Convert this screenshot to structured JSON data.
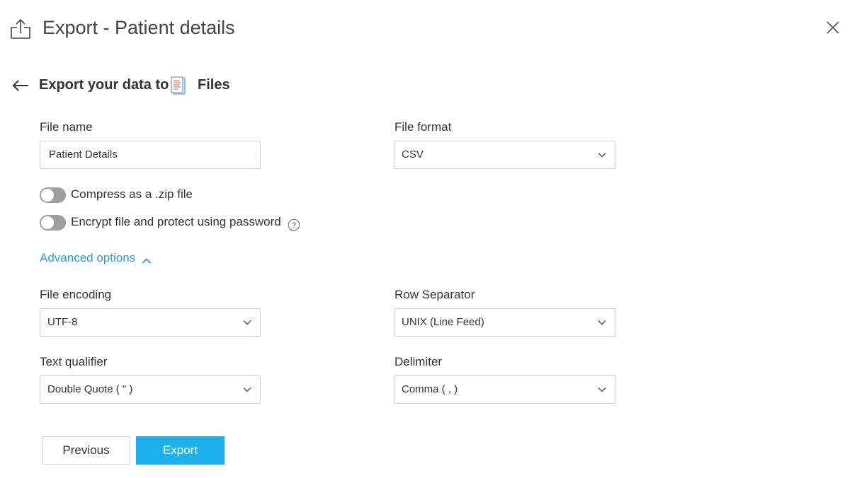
{
  "header": {
    "title": "Export - Patient details"
  },
  "subheader": {
    "prefix": "Export your data to",
    "destination": "Files"
  },
  "form": {
    "file_name": {
      "label": "File name",
      "value": "Patient Details"
    },
    "file_format": {
      "label": "File format",
      "value": "CSV"
    },
    "compress": {
      "label": "Compress as a .zip file",
      "enabled": false
    },
    "encrypt": {
      "label": "Encrypt file and protect using password",
      "enabled": false
    }
  },
  "advanced": {
    "toggle_label": "Advanced options",
    "file_encoding": {
      "label": "File encoding",
      "value": "UTF-8"
    },
    "row_separator": {
      "label": "Row Separator",
      "value": "UNIX (Line Feed)"
    },
    "text_qualifier": {
      "label": "Text qualifier",
      "value": "Double Quote ( \" )"
    },
    "delimiter": {
      "label": "Delimiter",
      "value": "Comma ( , )"
    }
  },
  "actions": {
    "previous_label": "Previous",
    "export_label": "Export"
  },
  "icons": {
    "export": "export-icon",
    "close": "close-icon",
    "back": "back-arrow-icon",
    "files": "file-document-icon",
    "chevron": "chevron-down-icon",
    "help": "help-icon"
  },
  "colors": {
    "accent": "#1ea2e1",
    "primary_button": "#1eb0ec",
    "toggle_off": "#9e9e9e"
  }
}
